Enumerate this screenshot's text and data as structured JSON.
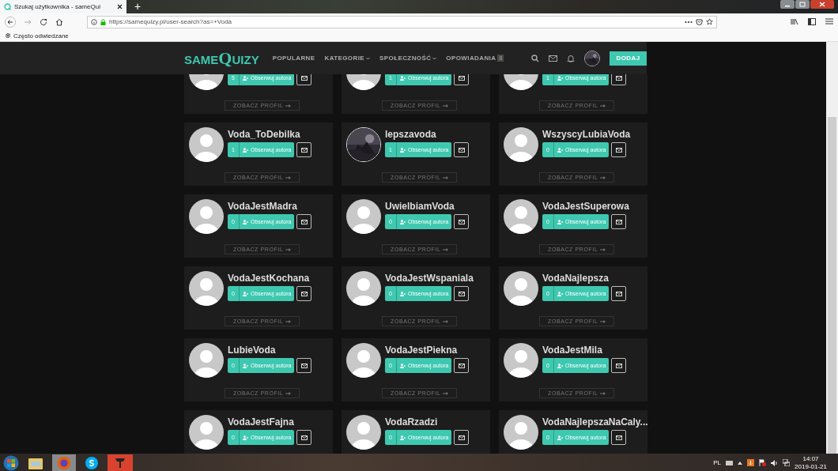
{
  "browser": {
    "tab_title": "Szukaj użytkownika - sameQui",
    "new_tab": "+",
    "url": "https://samequizy.pl/user-search?as=+Voda",
    "bookmarks": [
      {
        "label": "Często odwiedzane"
      }
    ]
  },
  "site": {
    "logo": "SAMEQUIZY",
    "nav": [
      {
        "label": "POPULARNE",
        "dropdown": false
      },
      {
        "label": "KATEGORIE",
        "dropdown": true
      },
      {
        "label": "SPOŁECZNOŚĆ",
        "dropdown": true
      },
      {
        "label": "OPOWIADANIA",
        "dropdown": false,
        "badge": "8"
      }
    ],
    "add_button": "DODAJ"
  },
  "users": [
    {
      "kind": "default",
      "followers": "5",
      "follow_label": "Obserwuj autora",
      "profile_link": "ZOBACZ PROFIL"
    },
    {
      "kind": "default",
      "followers": "1",
      "follow_label": "Obserwuj autora",
      "profile_link": "ZOBACZ PROFIL"
    },
    {
      "kind": "default",
      "followers": "1",
      "follow_label": "Obserwuj autora",
      "profile_link": "ZOBACZ PROFIL"
    },
    {
      "kind": "default",
      "name": "Voda_ToDebilka",
      "followers": "1",
      "follow_label": "Obserwuj autora",
      "profile_link": "ZOBACZ PROFIL"
    },
    {
      "name": "lepszavoda",
      "followers": "1",
      "follow_label": "Obserwuj autora",
      "profile_link": "ZOBACZ PROFIL"
    },
    {
      "kind": "default",
      "name": "WszyscyLubiaVoda",
      "followers": "0",
      "follow_label": "Obserwuj autora",
      "profile_link": "ZOBACZ PROFIL"
    },
    {
      "kind": "default",
      "name": "VodaJestMadra",
      "followers": "0",
      "follow_label": "Obserwuj autora",
      "profile_link": "ZOBACZ PROFIL"
    },
    {
      "kind": "default",
      "name": "UwielbiamVoda",
      "followers": "0",
      "follow_label": "Obserwuj autora",
      "profile_link": "ZOBACZ PROFIL"
    },
    {
      "kind": "default",
      "name": "VodaJestSuperowa",
      "followers": "0",
      "follow_label": "Obserwuj autora",
      "profile_link": "ZOBACZ PROFIL"
    },
    {
      "kind": "default",
      "name": "VodaJestKochana",
      "followers": "0",
      "follow_label": "Obserwuj autora",
      "profile_link": "ZOBACZ PROFIL"
    },
    {
      "kind": "default",
      "name": "VodaJestWspaniala",
      "followers": "0",
      "follow_label": "Obserwuj autora",
      "profile_link": "ZOBACZ PROFIL"
    },
    {
      "kind": "default",
      "name": "VodaNajlepsza",
      "followers": "0",
      "follow_label": "Obserwuj autora",
      "profile_link": "ZOBACZ PROFIL"
    },
    {
      "kind": "default",
      "name": "LubieVoda",
      "followers": "0",
      "follow_label": "Obserwuj autora",
      "profile_link": "ZOBACZ PROFIL"
    },
    {
      "kind": "default",
      "name": "VodaJestPiekna",
      "followers": "0",
      "follow_label": "Obserwuj autora",
      "profile_link": "ZOBACZ PROFIL"
    },
    {
      "kind": "default",
      "name": "VodaJestMila",
      "followers": "0",
      "follow_label": "Obserwuj autora",
      "profile_link": "ZOBACZ PROFIL"
    },
    {
      "kind": "default",
      "name": "VodaJestFajna",
      "followers": "0",
      "follow_label": "Obserwuj autora"
    },
    {
      "kind": "default",
      "name": "VodaRzadzi",
      "followers": "0",
      "follow_label": "Obserwuj autora"
    },
    {
      "kind": "default",
      "name": "VodaNajlepszaNaCaly...",
      "followers": "0",
      "follow_label": "Obserwuj autora"
    }
  ],
  "taskbar": {
    "language": "PL",
    "time": "14:07",
    "date": "2019-01-21"
  }
}
